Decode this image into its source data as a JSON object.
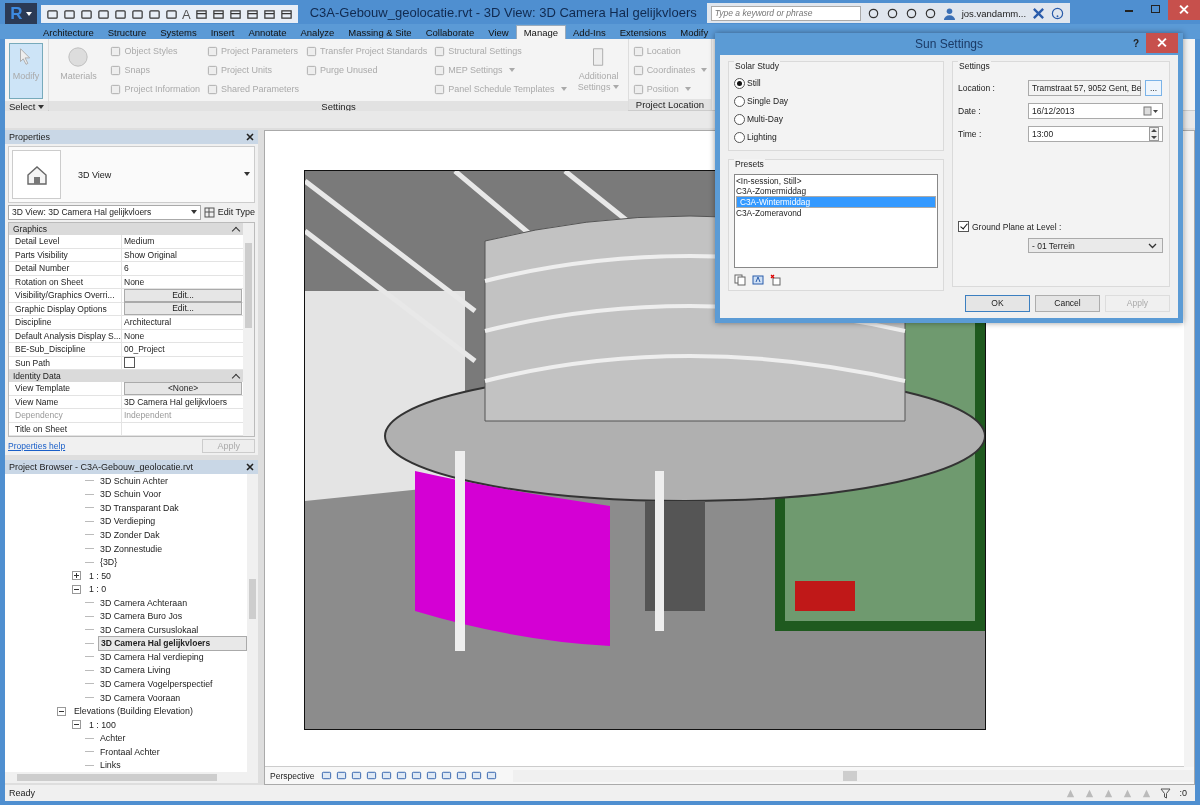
{
  "window": {
    "logo": "R",
    "title": "C3A-Gebouw_geolocatie.rvt - 3D View: 3D Camera Hal gelijkvloers",
    "quick_access_text": "A",
    "search_placeholder": "Type a keyword or phrase",
    "user": "jos.vandamm..."
  },
  "ribbon": {
    "tabs": [
      {
        "label": "Architecture",
        "selected": false
      },
      {
        "label": "Structure",
        "selected": false
      },
      {
        "label": "Systems",
        "selected": false
      },
      {
        "label": "Insert",
        "selected": false
      },
      {
        "label": "Annotate",
        "selected": false
      },
      {
        "label": "Analyze",
        "selected": false
      },
      {
        "label": "Massing & Site",
        "selected": false
      },
      {
        "label": "Collaborate",
        "selected": false
      },
      {
        "label": "View",
        "selected": false
      },
      {
        "label": "Manage",
        "selected": true
      },
      {
        "label": "Add-Ins",
        "selected": false
      },
      {
        "label": "Extensions",
        "selected": false
      },
      {
        "label": "Modify",
        "selected": false
      }
    ],
    "panels": [
      {
        "label": "Select",
        "dropdown": true,
        "columns": [
          [
            {
              "label": "Modify",
              "kind": "large",
              "active": true,
              "dropdown": false
            }
          ]
        ]
      },
      {
        "label": "Settings",
        "dropdown": false,
        "columns": [
          [
            {
              "label": "Materials",
              "kind": "large",
              "active": false,
              "dropdown": false
            }
          ],
          [
            {
              "label": "Object Styles",
              "kind": "small",
              "active": false,
              "dropdown": false
            },
            {
              "label": "Snaps",
              "kind": "small",
              "active": false,
              "dropdown": false
            },
            {
              "label": "Project Information",
              "kind": "small",
              "active": false,
              "dropdown": false
            }
          ],
          [
            {
              "label": "Project Parameters",
              "kind": "small",
              "active": false,
              "dropdown": false
            },
            {
              "label": "Project Units",
              "kind": "small",
              "active": false,
              "dropdown": false
            },
            {
              "label": "Shared Parameters",
              "kind": "small",
              "active": false,
              "dropdown": false
            }
          ],
          [
            {
              "label": "Transfer Project Standards",
              "kind": "small",
              "active": false,
              "dropdown": false
            },
            {
              "label": "Purge Unused",
              "kind": "small",
              "active": false,
              "dropdown": false
            }
          ],
          [
            {
              "label": "Structural Settings",
              "kind": "small",
              "active": false,
              "dropdown": false
            },
            {
              "label": "MEP Settings",
              "kind": "small",
              "active": false,
              "dropdown": true
            },
            {
              "label": "Panel Schedule Templates",
              "kind": "small",
              "active": false,
              "dropdown": true
            }
          ],
          [
            {
              "label": "Additional Settings",
              "kind": "large",
              "active": false,
              "dropdown": true
            }
          ]
        ]
      },
      {
        "label": "Project Location",
        "dropdown": false,
        "columns": [
          [
            {
              "label": "Location",
              "kind": "small",
              "active": false,
              "dropdown": false
            },
            {
              "label": "Coordinates",
              "kind": "small",
              "active": false,
              "dropdown": true
            },
            {
              "label": "Position",
              "kind": "small",
              "active": false,
              "dropdown": true
            }
          ]
        ]
      }
    ]
  },
  "properties": {
    "title": "Properties",
    "type_name": "3D View",
    "selector": "3D View: 3D Camera Hal gelijkvloers",
    "edit_type": "Edit Type",
    "groups": [
      {
        "name": "Graphics",
        "rows": [
          {
            "label": "Detail Level",
            "value": "Medium",
            "kind": "text",
            "disabled": false
          },
          {
            "label": "Parts Visibility",
            "value": "Show Original",
            "kind": "text",
            "disabled": false
          },
          {
            "label": "Detail Number",
            "value": "6",
            "kind": "text",
            "disabled": false
          },
          {
            "label": "Rotation on Sheet",
            "value": "None",
            "kind": "text",
            "disabled": false
          },
          {
            "label": "Visibility/Graphics Overri...",
            "value": "Edit...",
            "kind": "button",
            "disabled": false
          },
          {
            "label": "Graphic Display Options",
            "value": "Edit...",
            "kind": "button",
            "disabled": false
          },
          {
            "label": "Discipline",
            "value": "Architectural",
            "kind": "text",
            "disabled": false
          },
          {
            "label": "Default Analysis Display S...",
            "value": "None",
            "kind": "text",
            "disabled": false
          },
          {
            "label": "BE-Sub_Discipline",
            "value": "00_Project",
            "kind": "text",
            "disabled": false
          },
          {
            "label": "Sun Path",
            "kind": "checkbox",
            "checked": false,
            "disabled": false
          }
        ]
      },
      {
        "name": "Identity Data",
        "rows": [
          {
            "label": "View Template",
            "value": "<None>",
            "kind": "button",
            "disabled": false
          },
          {
            "label": "View Name",
            "value": "3D Camera Hal gelijkvloers",
            "kind": "text",
            "disabled": false
          },
          {
            "label": "Dependency",
            "value": "Independent",
            "kind": "text",
            "disabled": true
          },
          {
            "label": "Title on Sheet",
            "kind": "text",
            "disabled": false
          }
        ]
      }
    ],
    "help": "Properties help",
    "apply": "Apply"
  },
  "project_browser": {
    "title": "Project Browser - C3A-Gebouw_geolocatie.rvt",
    "tree": [
      {
        "children": [
          {
            "children": [
              {
                "label": "3D Schuin Achter",
                "selected": false
              },
              {
                "label": "3D Schuin Voor",
                "selected": false
              },
              {
                "label": "3D Transparant Dak",
                "selected": false
              },
              {
                "label": "3D Verdieping",
                "selected": false
              },
              {
                "label": "3D Zonder Dak",
                "selected": false
              },
              {
                "label": "3D Zonnestudie",
                "selected": false
              },
              {
                "label": "{3D}",
                "selected": false
              }
            ]
          },
          {
            "label": "1 : 50",
            "expanded": false,
            "selected": false
          },
          {
            "label": "1 : 0",
            "expanded": true,
            "selected": false,
            "children": [
              {
                "label": "3D Camera Achteraan",
                "selected": false
              },
              {
                "label": "3D Camera Buro Jos",
                "selected": false
              },
              {
                "label": "3D Camera Cursuslokaal",
                "selected": false
              },
              {
                "label": "3D Camera Hal gelijkvloers",
                "selected": true
              },
              {
                "label": "3D Camera Hal verdieping",
                "selected": false
              },
              {
                "label": "3D Camera Living",
                "selected": false
              },
              {
                "label": "3D Camera Vogelperspectief",
                "selected": false
              },
              {
                "label": "3D Camera Vooraan",
                "selected": false
              }
            ]
          }
        ]
      },
      {
        "label": "Elevations (Building Elevation)",
        "expanded": true,
        "selected": false,
        "children": [
          {
            "label": "1 : 100",
            "expanded": true,
            "selected": false,
            "children": [
              {
                "label": "Achter",
                "selected": false
              },
              {
                "label": "Frontaal Achter",
                "selected": false
              },
              {
                "label": "Links",
                "selected": false
              }
            ]
          }
        ]
      }
    ]
  },
  "view_bar": {
    "label": "Perspective"
  },
  "status_bar": {
    "text": "Ready",
    "filter_count": ":0"
  },
  "dialog": {
    "title": "Sun Settings",
    "help": "?",
    "solar_study": {
      "label": "Solar Study",
      "options": [
        {
          "label": "Still",
          "selected": true
        },
        {
          "label": "Single Day",
          "selected": false
        },
        {
          "label": "Multi-Day",
          "selected": false
        },
        {
          "label": "Lighting",
          "selected": false
        }
      ]
    },
    "presets": {
      "label": "Presets",
      "items": [
        {
          "label": "<In-session, Still>",
          "selected": false
        },
        {
          "label": "C3A-Zomermiddag",
          "selected": false
        },
        {
          "label": "C3A-Wintermiddag",
          "selected": true
        },
        {
          "label": "C3A-Zomeravond",
          "selected": false
        }
      ]
    },
    "settings": {
      "label": "Settings",
      "location_label": "Location :",
      "location": "Tramstraat 57, 9052 Gent, Be",
      "browse": "...",
      "date_label": "Date :",
      "date": "16/12/2013",
      "time_label": "Time :",
      "time": "13:00",
      "ground_plane_label": "Ground Plane at Level :",
      "ground_plane": true,
      "level": "- 01 Terrein"
    },
    "buttons": [
      {
        "label": "OK",
        "default": true,
        "disabled": false
      },
      {
        "label": "Cancel",
        "default": false,
        "disabled": false
      },
      {
        "label": "Apply",
        "default": false,
        "disabled": true
      }
    ]
  }
}
